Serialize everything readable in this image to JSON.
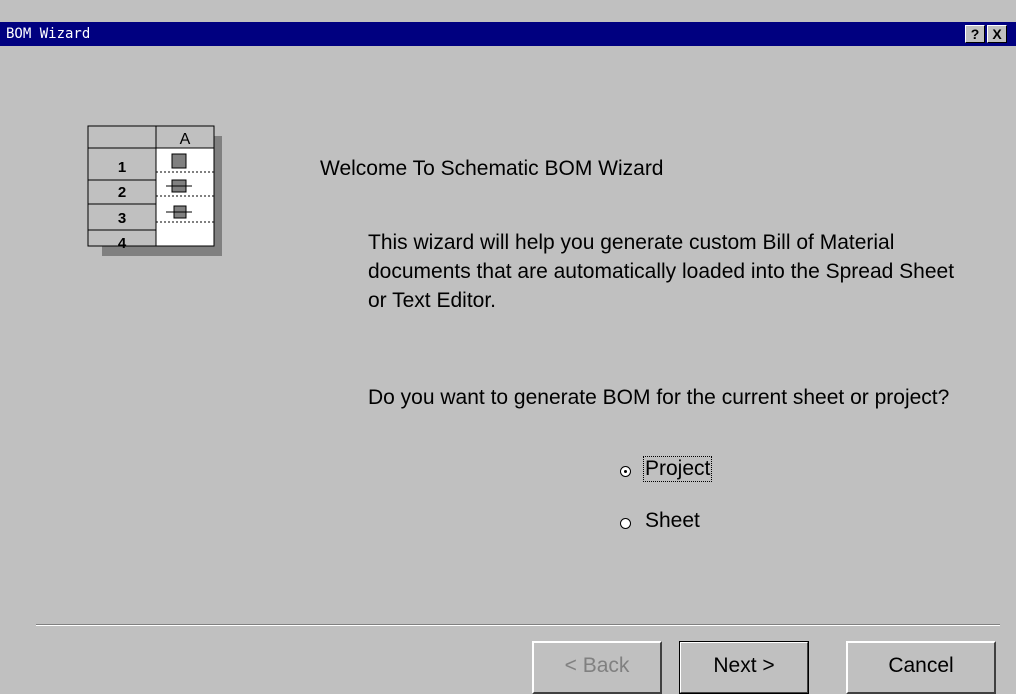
{
  "window": {
    "title": "BOM Wizard"
  },
  "titlebar_buttons": {
    "help": "?",
    "close": "X"
  },
  "icon": {
    "column_header": "A",
    "row_numbers": [
      "1",
      "2",
      "3",
      "4"
    ]
  },
  "content": {
    "welcome": "Welcome To Schematic BOM Wizard",
    "description": "This wizard will help you generate custom Bill of Material documents that are automatically loaded into the Spread Sheet or Text Editor.",
    "question": "Do you want to generate BOM for the current sheet or project?"
  },
  "options": [
    {
      "label": "Project",
      "selected": true
    },
    {
      "label": "Sheet",
      "selected": false
    }
  ],
  "buttons": {
    "back": "< Back",
    "next": "Next >",
    "cancel": "Cancel"
  }
}
